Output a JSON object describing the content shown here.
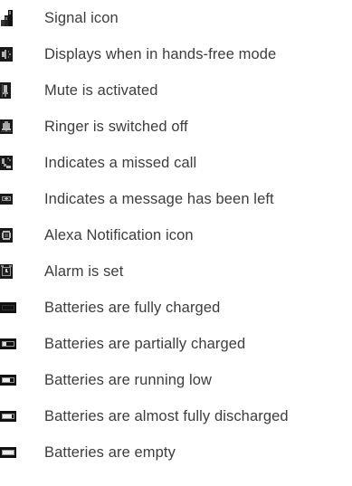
{
  "items": [
    {
      "label": "Signal icon",
      "icon": "signal-icon"
    },
    {
      "label": "Displays when in hands-free mode",
      "icon": "speaker-icon"
    },
    {
      "label": "Mute is activated",
      "icon": "mute-icon"
    },
    {
      "label": "Ringer is switched off",
      "icon": "ringer-off-icon"
    },
    {
      "label": "Indicates a missed call",
      "icon": "missed-call-icon"
    },
    {
      "label": "Indicates a message has been left",
      "icon": "message-icon"
    },
    {
      "label": "Alexa Notification icon",
      "icon": "alexa-notification-icon"
    },
    {
      "label": "Alarm is set",
      "icon": "alarm-icon"
    },
    {
      "label": "Batteries are fully charged",
      "icon": "battery-full-icon"
    },
    {
      "label": "Batteries are partially charged",
      "icon": "battery-partial-icon"
    },
    {
      "label": "Batteries are running low",
      "icon": "battery-low-icon"
    },
    {
      "label": "Batteries are almost fully discharged",
      "icon": "battery-almost-empty-icon"
    },
    {
      "label": "Batteries are empty",
      "icon": "battery-empty-icon"
    }
  ],
  "colors": {
    "text": "#3d3d3d",
    "icon_dark": "#111111",
    "icon_mid": "#6a6a6a",
    "icon_light": "#b8b8b8"
  }
}
